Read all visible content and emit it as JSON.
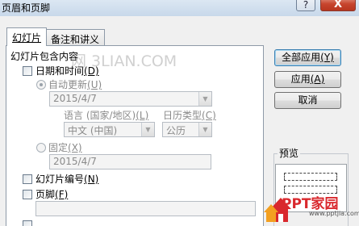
{
  "window": {
    "title": "页眉和页脚",
    "help_label": "?",
    "close_label": "X"
  },
  "tabs": [
    {
      "label": "幻灯片",
      "active": true
    },
    {
      "label": "备注和讲义",
      "active": false
    }
  ],
  "panel": {
    "group_label": "幻灯片包含内容",
    "datetime": {
      "label": "日期和时间",
      "key": "(D)",
      "checked": false
    },
    "auto_update": {
      "label": "自动更新",
      "key": "(U)",
      "selected": true
    },
    "auto_date_value": "2015/4/7",
    "language": {
      "label": "语言 (国家/地区)",
      "key": "(L)",
      "value": "中文 (中国)"
    },
    "calendar": {
      "label": "日历类型",
      "key": "(C)",
      "value": "公历"
    },
    "fixed": {
      "label": "固定",
      "key": "(X)",
      "selected": false
    },
    "fixed_value": "2015/4/7",
    "slide_number": {
      "label": "幻灯片编号",
      "key": "(N)",
      "checked": false
    },
    "footer": {
      "label": "页脚",
      "key": "(F)",
      "checked": false,
      "value": ""
    }
  },
  "buttons": {
    "apply_all": {
      "label": "全部应用",
      "key": "(Y)"
    },
    "apply": {
      "label": "应用",
      "key": "(A)"
    },
    "cancel": {
      "label": "取消"
    }
  },
  "preview": {
    "label": "预览"
  },
  "watermark": {
    "text": "网 3LIAN.COM"
  },
  "logo": {
    "text": "PPT家园",
    "sub": "www.pptjia.com"
  },
  "colors": {
    "accent": "#3c7fb1",
    "logo_red": "#d9282d"
  }
}
